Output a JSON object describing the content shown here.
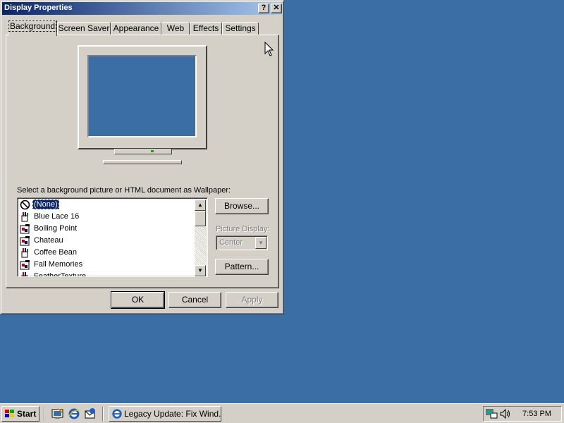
{
  "window": {
    "title": "Display Properties",
    "help_label": "?",
    "close_label": "✕"
  },
  "tabs": [
    {
      "label": "Background",
      "active": true
    },
    {
      "label": "Screen Saver",
      "active": false
    },
    {
      "label": "Appearance",
      "active": false
    },
    {
      "label": "Web",
      "active": false
    },
    {
      "label": "Effects",
      "active": false
    },
    {
      "label": "Settings",
      "active": false
    }
  ],
  "wallpaper": {
    "prompt": "Select a background picture or HTML document as Wallpaper:",
    "items": [
      {
        "label": "(None)",
        "icon": "none-icon",
        "selected": true
      },
      {
        "label": "Blue Lace 16",
        "icon": "paint-bucket-icon",
        "selected": false
      },
      {
        "label": "Boiling Point",
        "icon": "bitmap-icon",
        "selected": false
      },
      {
        "label": "Chateau",
        "icon": "bitmap-icon",
        "selected": false
      },
      {
        "label": "Coffee Bean",
        "icon": "paint-bucket-icon",
        "selected": false
      },
      {
        "label": "Fall Memories",
        "icon": "bitmap-icon",
        "selected": false
      },
      {
        "label": "FeatherTexture",
        "icon": "paint-bucket-icon",
        "selected": false
      }
    ],
    "browse_label": "Browse...",
    "picture_display_label": "Picture Display:",
    "picture_display_value": "Center",
    "pattern_label": "Pattern..."
  },
  "footer": {
    "ok_label": "OK",
    "cancel_label": "Cancel",
    "apply_label": "Apply"
  },
  "taskbar": {
    "start_label": "Start",
    "task_label": "Legacy Update: Fix Wind...",
    "clock": "7:53 PM",
    "quick_launch": [
      "show-desktop-icon",
      "internet-explorer-icon",
      "outlook-express-icon"
    ]
  },
  "colors": {
    "desktop": "#3a6ea5",
    "title_start": "#0a246a",
    "title_end": "#a6caf0",
    "face": "#d4d0c8",
    "selection": "#0a246a"
  }
}
